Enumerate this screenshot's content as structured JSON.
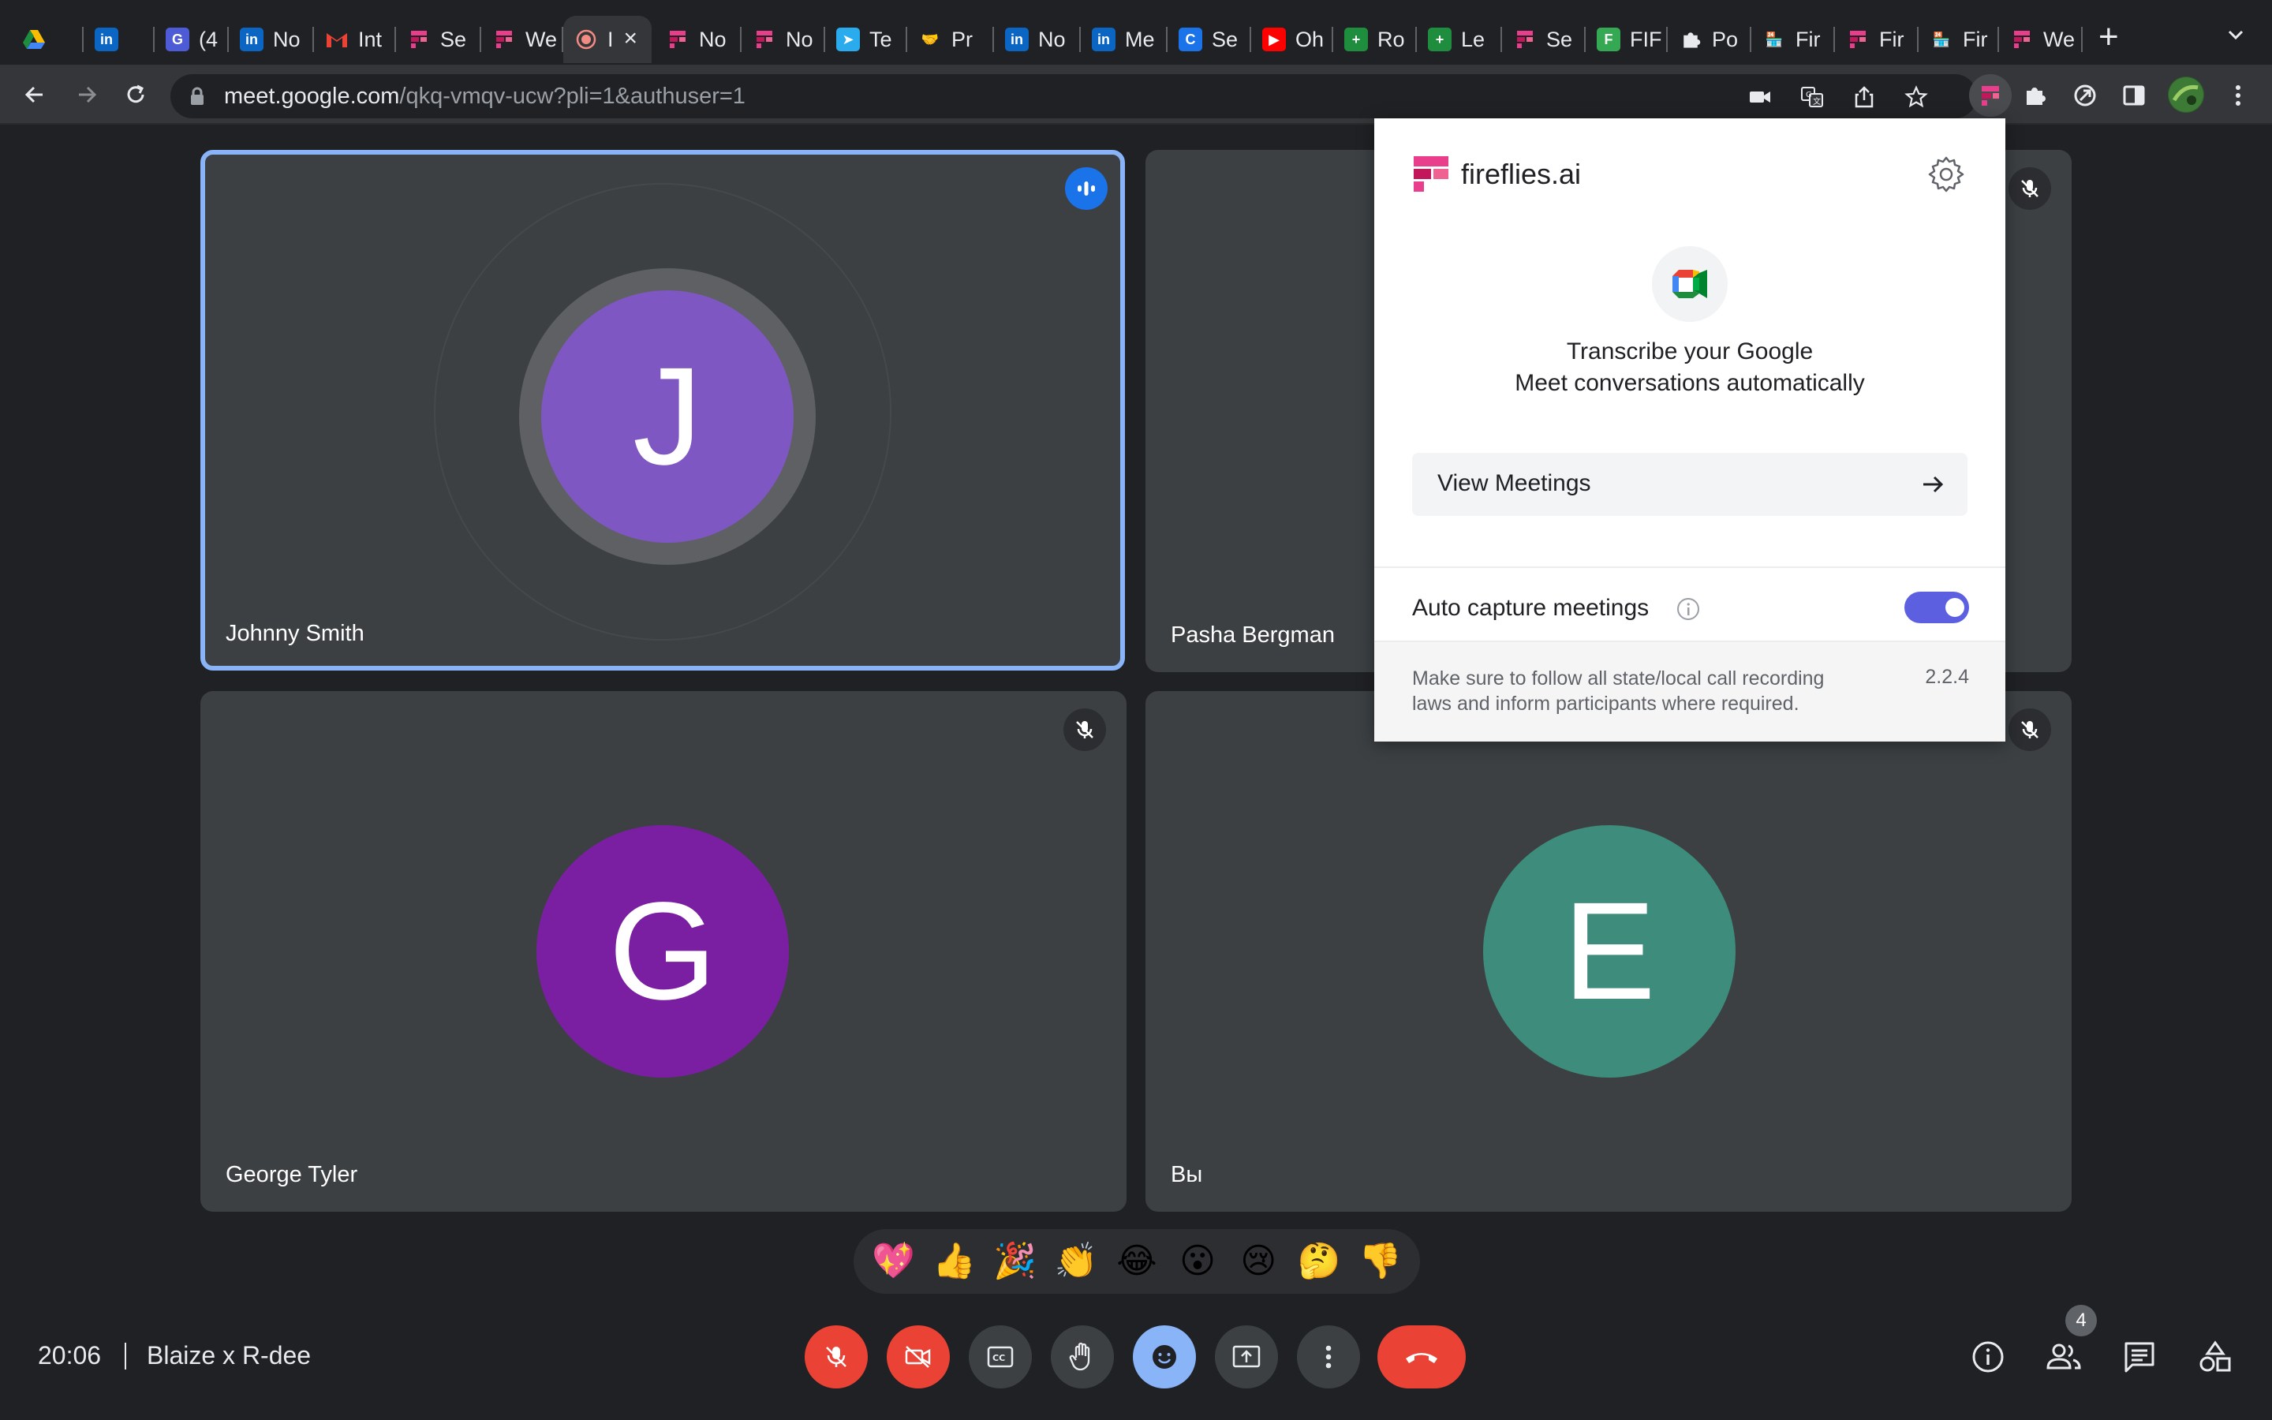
{
  "browser": {
    "tabs": [
      {
        "title": "",
        "icon": "google-drive-icon"
      },
      {
        "title": "",
        "icon": "linkedin-icon"
      },
      {
        "title": "(4",
        "icon": "notification-app-icon"
      },
      {
        "title": "No",
        "icon": "linkedin-icon"
      },
      {
        "title": "Int",
        "icon": "gmail-icon"
      },
      {
        "title": "Se",
        "icon": "fireflies-icon"
      },
      {
        "title": "We",
        "icon": "fireflies-icon"
      },
      {
        "title": "I",
        "icon": "recording-icon",
        "active": true
      },
      {
        "title": "No",
        "icon": "fireflies-icon"
      },
      {
        "title": "No",
        "icon": "fireflies-icon"
      },
      {
        "title": "Te",
        "icon": "telegram-icon"
      },
      {
        "title": "Pr",
        "icon": "handshake-icon"
      },
      {
        "title": "No",
        "icon": "linkedin-icon"
      },
      {
        "title": "Me",
        "icon": "linkedin-icon"
      },
      {
        "title": "Se",
        "icon": "grammarly-icon"
      },
      {
        "title": "Oh",
        "icon": "youtube-icon"
      },
      {
        "title": "Ro",
        "icon": "sheets-icon"
      },
      {
        "title": "Le",
        "icon": "sheets-icon"
      },
      {
        "title": "Se",
        "icon": "fireflies-icon"
      },
      {
        "title": "FIF",
        "icon": "feathery-icon"
      },
      {
        "title": "Po",
        "icon": "puzzle-icon"
      },
      {
        "title": "Fir",
        "icon": "store-icon"
      },
      {
        "title": "Fir",
        "icon": "fireflies-icon"
      },
      {
        "title": "Fir",
        "icon": "store-icon"
      },
      {
        "title": "We",
        "icon": "fireflies-icon"
      }
    ],
    "url_host": "meet.google.com",
    "url_path": "/qkq-vmqv-ucw?pli=1&authuser=1"
  },
  "participants": [
    {
      "name": "Johnny Smith",
      "initial": "J",
      "color": "#7e57c2",
      "speaking": true
    },
    {
      "name": "Pasha Bergman",
      "initial": "",
      "color": "#3c4043",
      "muted": true
    },
    {
      "name": "George Tyler",
      "initial": "G",
      "color": "#7b1fa2",
      "muted": true
    },
    {
      "name": "Вы",
      "initial": "E",
      "color": "#3e8c7c",
      "muted": true
    }
  ],
  "fireflies": {
    "brand": "fireflies.ai",
    "headline_line1": "Transcribe your Google",
    "headline_line2": "Meet conversations automatically",
    "view_meetings": "View Meetings",
    "auto_capture_label": "Auto capture meetings",
    "auto_capture_on": true,
    "note": "Make sure to follow all state/local call recording laws and inform participants where required.",
    "version": "2.2.4",
    "accent": "#5b5fe0"
  },
  "reactions": [
    "💖",
    "👍",
    "🎉",
    "👏",
    "😂",
    "😮",
    "😢",
    "🤔",
    "👎"
  ],
  "meeting": {
    "time": "20:06",
    "name": "Blaize x R-dee",
    "participant_count": "4"
  },
  "colors": {
    "meet_background": "#202124",
    "tile": "#3c4043",
    "active_speaker_border": "#8ab4f8",
    "danger": "#ea4335"
  }
}
